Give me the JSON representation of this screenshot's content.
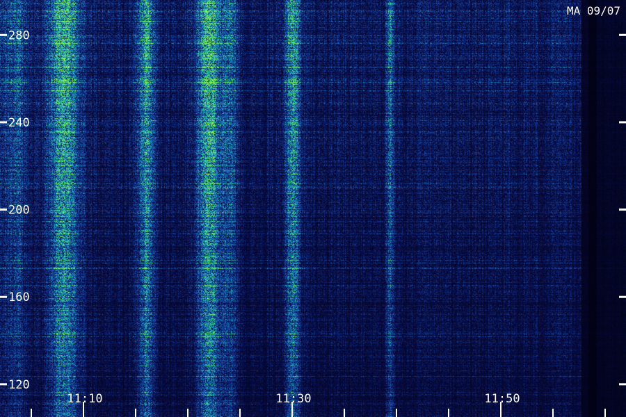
{
  "station_label": "MA 09/07",
  "colors": {
    "background": "#000000",
    "axis": "#ffffff",
    "low": "#06083a",
    "mid": "#1b4fb0",
    "high": "#16c7c0",
    "peak": "#7ff04a"
  },
  "chart_data": {
    "type": "heatmap",
    "title": "",
    "xlabel": "",
    "ylabel": "",
    "y_ticks": [
      "120",
      "160",
      "200",
      "240",
      "280"
    ],
    "y_tick_values": [
      120,
      160,
      200,
      240,
      280
    ],
    "ylim": [
      112,
      296
    ],
    "x_ticks": [
      "11:10",
      "11:30",
      "11:50"
    ],
    "x_tick_minutes": [
      10,
      30,
      50
    ],
    "xlim_minutes": [
      2,
      62
    ],
    "grid": false,
    "legend": "none"
  }
}
